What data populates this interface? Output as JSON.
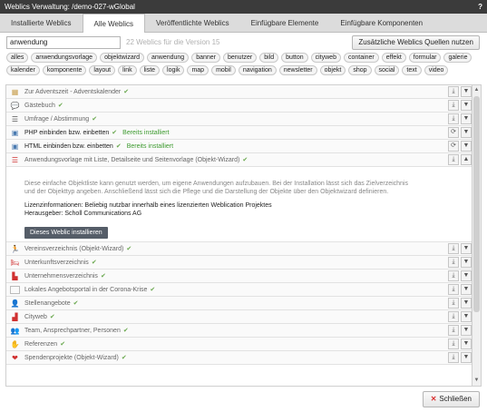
{
  "window": {
    "title": "Weblics Verwaltung: /demo-027-wGlobal",
    "help": "?"
  },
  "tabs": [
    "Installierte Weblics",
    "Alle Weblics",
    "Veröffentlichte Weblics",
    "Einfügbare Elemente",
    "Einfügbare Komponenten"
  ],
  "search": {
    "value": "anwendung",
    "count_text": "22 Weblics für die Version 15"
  },
  "sources_button": "Zusätzliche Weblics Quellen nutzen",
  "tags": [
    "alles",
    "anwendungsvorlage",
    "objektwizard",
    "anwendung",
    "banner",
    "benutzer",
    "bild",
    "button",
    "cityweb",
    "container",
    "effekt",
    "formular",
    "galerie",
    "kalender",
    "komponente",
    "layout",
    "link",
    "liste",
    "logik",
    "map",
    "mobil",
    "navigation",
    "newsletter",
    "objekt",
    "shop",
    "social",
    "text",
    "video"
  ],
  "rows_top": [
    {
      "icon": "calendar-icon",
      "glyph": "▦",
      "color": "#c8a050",
      "label": "Zur Adventszeit - Adventskalender",
      "dark": false,
      "installed": ""
    },
    {
      "icon": "speech-bubble-icon",
      "glyph": "💬",
      "color": "#e0a020",
      "label": "Gästebuch",
      "dark": false,
      "installed": ""
    },
    {
      "icon": "list-icon",
      "glyph": "☰",
      "color": "#555555",
      "label": "Umfrage / Abstimmung",
      "dark": false,
      "installed": ""
    },
    {
      "icon": "php-icon",
      "glyph": "▣",
      "color": "#4a7ab0",
      "label": "PHP einbinden bzw. einbetten",
      "dark": true,
      "installed": "Bereits installiert"
    },
    {
      "icon": "html-icon",
      "glyph": "▣",
      "color": "#4a7ab0",
      "label": "HTML einbinden bzw. einbetten",
      "dark": true,
      "installed": "Bereits installiert"
    },
    {
      "icon": "list-template-icon",
      "glyph": "☰",
      "color": "#d03030",
      "label": "Anwendungsvorlage mit Liste, Detailseite und Seitenvorlage (Objekt-Wizard)",
      "dark": false,
      "installed": ""
    }
  ],
  "detail": {
    "description": "Diese einfache Objektliste kann genutzt werden, um eigene Anwendungen aufzubauen. Bei der Installation lässt sich das Zielverzeichnis und der Objekttyp angeben. Anschließend lässt sich die Pflege und die Darstellung der Objekte über den Objektwizard definieren.",
    "license": "Lizenzinformationen: Beliebig nutzbar innerhalb eines lizenzierten Weblication Projektes",
    "publisher": "Herausgeber: Scholl Communications AG",
    "install_button": "Dieses Weblic installieren"
  },
  "rows_bottom": [
    {
      "icon": "running-person-icon",
      "glyph": "🏃",
      "color": "#d03030",
      "label": "Vereinsverzeichnis (Objekt-Wizard)"
    },
    {
      "icon": "bed-icon",
      "glyph": "🛏",
      "color": "#d03030",
      "label": "Unterkunftsverzeichnis"
    },
    {
      "icon": "factory-icon",
      "glyph": "▙",
      "color": "#d03030",
      "label": "Unternehmensverzeichnis"
    },
    {
      "icon": "blank-icon",
      "glyph": "",
      "color": "#ffffff",
      "label": "Lokales Angebotsportal in der Corona-Krise"
    },
    {
      "icon": "person-icon",
      "glyph": "👤",
      "color": "#d03030",
      "label": "Stellenangebote"
    },
    {
      "icon": "city-icon",
      "glyph": "▟",
      "color": "#d03030",
      "label": "Cityweb"
    },
    {
      "icon": "team-icon",
      "glyph": "👥",
      "color": "#d03030",
      "label": "Team, Ansprechpartner, Personen"
    },
    {
      "icon": "handshake-icon",
      "glyph": "✋",
      "color": "#d03030",
      "label": "Referenzen"
    },
    {
      "icon": "heart-icon",
      "glyph": "❤",
      "color": "#d03030",
      "label": "Spendenprojekte (Objekt-Wizard)"
    }
  ],
  "close_button": "Schließen"
}
